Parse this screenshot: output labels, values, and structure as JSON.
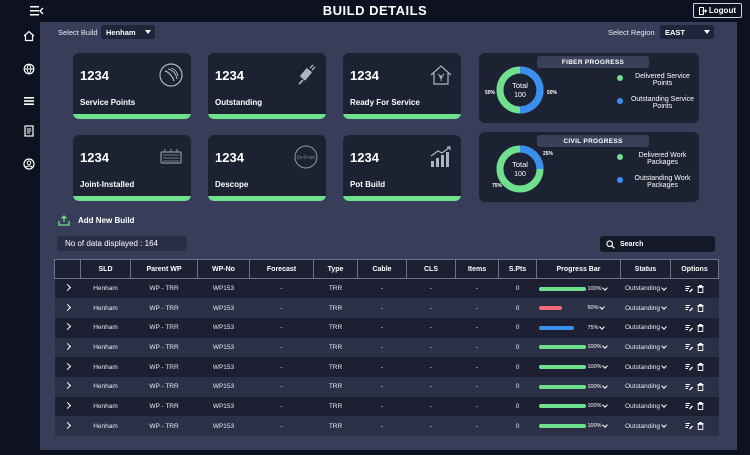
{
  "header": {
    "title": "BUILD DETAILS",
    "logout_label": "Logout"
  },
  "filters": {
    "build_label": "Select Build",
    "build_value": "Henham",
    "region_label": "Select Region",
    "region_value": "EAST"
  },
  "cards": [
    {
      "value": "1234",
      "label": "Service Points",
      "icon": "satellite-dish-icon"
    },
    {
      "value": "1234",
      "label": "Outstanding",
      "icon": "cable-plug-icon"
    },
    {
      "value": "1234",
      "label": "Ready For Service",
      "icon": "house-network-icon"
    },
    {
      "value": "1234",
      "label": "Joint-Installed",
      "icon": "server-rack-icon"
    },
    {
      "value": "1234",
      "label": "Descope",
      "icon": "descope-badge-icon",
      "icon_text": "De-Scope"
    },
    {
      "value": "1234",
      "label": "Pot Build",
      "icon": "bar-growth-icon"
    }
  ],
  "fiber_progress": {
    "title": "FIBER PROGRESS",
    "center_label": "Total",
    "center_value": "100",
    "left_pct": "50%",
    "right_pct": "50%",
    "completed_fraction": 0.5,
    "legend": [
      "Delivered Service Points",
      "Outstanding Service Points"
    ]
  },
  "civil_progress": {
    "title": "CIVIL PROGRESS",
    "center_label": "Total",
    "center_value": "100",
    "top_pct": "25%",
    "left_pct": "75%",
    "completed_fraction": 0.75,
    "legend": [
      "Delivered Work Packages",
      "Outstanding Work Packages"
    ]
  },
  "colors": {
    "green": "#6fe08d",
    "blue": "#3a8ff0",
    "red": "#f06b7a"
  },
  "actions": {
    "add_build_label": "Add New Build"
  },
  "count": {
    "label": "No of data displayed :",
    "value": "164"
  },
  "search": {
    "label": "Search"
  },
  "table": {
    "headers": [
      "",
      "SLD",
      "Parent WP",
      "WP-No",
      "Forecast",
      "Type",
      "Cable",
      "CLS",
      "Items",
      "S.Pts",
      "Progress Bar",
      "Status",
      "Options"
    ],
    "rows": [
      {
        "sld": "Henham",
        "parent": "WP - TRR",
        "wp": "WP153",
        "forecast": "-",
        "type": "TRR",
        "cable": "-",
        "cls": "-",
        "items": "-",
        "spts": "0",
        "progress": 100,
        "progress_label": "100%",
        "color": "green",
        "status": "Outstanding"
      },
      {
        "sld": "Henham",
        "parent": "WP - TRR",
        "wp": "WP153",
        "forecast": "-",
        "type": "TRR",
        "cable": "-",
        "cls": "-",
        "items": "-",
        "spts": "0",
        "progress": 50,
        "progress_label": "50%",
        "color": "red",
        "status": "Outstanding"
      },
      {
        "sld": "Henham",
        "parent": "WP - TRR",
        "wp": "WP153",
        "forecast": "-",
        "type": "TRR",
        "cable": "-",
        "cls": "-",
        "items": "-",
        "spts": "0",
        "progress": 75,
        "progress_label": "75%",
        "color": "blue",
        "status": "Outstanding"
      },
      {
        "sld": "Henham",
        "parent": "WP - TRR",
        "wp": "WP153",
        "forecast": "-",
        "type": "TRR",
        "cable": "-",
        "cls": "-",
        "items": "-",
        "spts": "0",
        "progress": 100,
        "progress_label": "100%",
        "color": "green",
        "status": "Outstanding"
      },
      {
        "sld": "Henham",
        "parent": "WP - TRR",
        "wp": "WP153",
        "forecast": "-",
        "type": "TRR",
        "cable": "-",
        "cls": "-",
        "items": "-",
        "spts": "0",
        "progress": 100,
        "progress_label": "100%",
        "color": "green",
        "status": "Outstanding"
      },
      {
        "sld": "Henham",
        "parent": "WP - TRR",
        "wp": "WP153",
        "forecast": "-",
        "type": "TRR",
        "cable": "-",
        "cls": "-",
        "items": "-",
        "spts": "0",
        "progress": 100,
        "progress_label": "100%",
        "color": "green",
        "status": "Outstanding"
      },
      {
        "sld": "Henham",
        "parent": "WP - TRR",
        "wp": "WP153",
        "forecast": "-",
        "type": "TRR",
        "cable": "-",
        "cls": "-",
        "items": "-",
        "spts": "0",
        "progress": 100,
        "progress_label": "100%",
        "color": "green",
        "status": "Outstanding"
      },
      {
        "sld": "Henham",
        "parent": "WP - TRR",
        "wp": "WP153",
        "forecast": "-",
        "type": "TRR",
        "cable": "-",
        "cls": "-",
        "items": "-",
        "spts": "0",
        "progress": 100,
        "progress_label": "100%",
        "color": "green",
        "status": "Outstanding"
      }
    ]
  }
}
